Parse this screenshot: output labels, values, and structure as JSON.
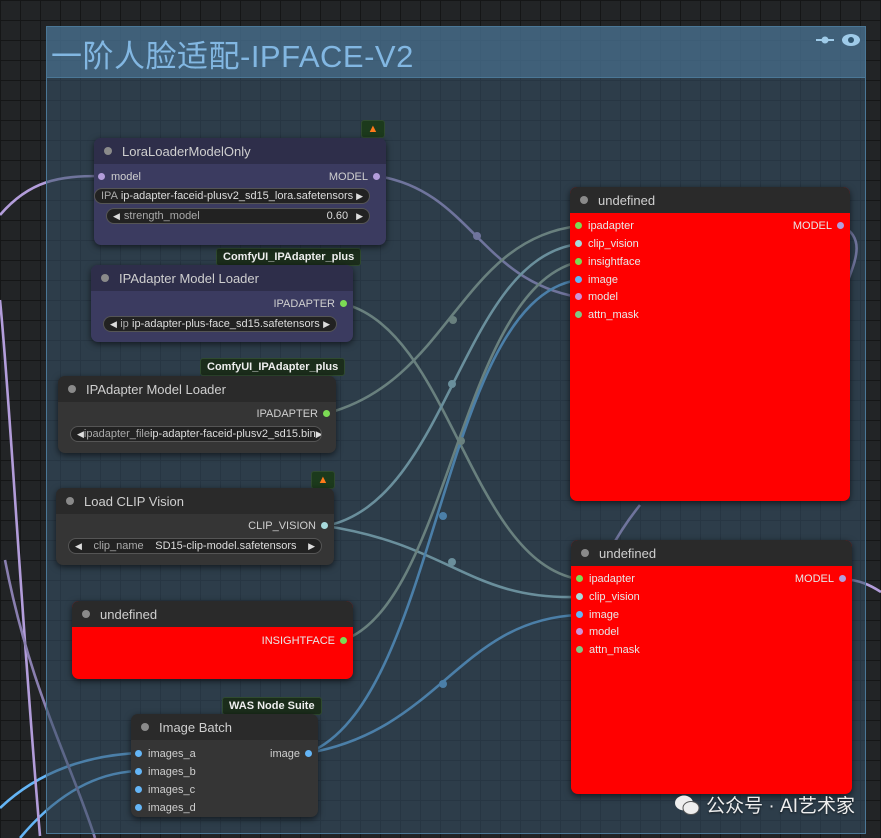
{
  "group": {
    "title": "一阶人脸适配-IPFACE-V2"
  },
  "colors": {
    "model": "#b39ddb",
    "ipadapter": "#7cdb54",
    "clip_vision": "#a8dadc",
    "insightface": "#7cdb54",
    "image": "#64b5f6",
    "mask": "#81c784",
    "red": "#ff0000"
  },
  "badges": {
    "ipadapter_plus_1": "ComfyUI_IPAdapter_plus",
    "ipadapter_plus_2": "ComfyUI_IPAdapter_plus",
    "was": "WAS Node Suite"
  },
  "lora": {
    "title": "LoraLoaderModelOnly",
    "in_model": "model",
    "out_model": "MODEL",
    "lora_label": "IPA",
    "lora_value": "ip-adapter-faceid-plusv2_sd15_lora.safetensors",
    "strength_label": "strength_model",
    "strength_value": "0.60"
  },
  "ipa_loader1": {
    "title": "IPAdapter Model Loader",
    "out": "IPADAPTER",
    "label": "ip",
    "value": "ip-adapter-plus-face_sd15.safetensors"
  },
  "ipa_loader2": {
    "title": "IPAdapter Model Loader",
    "out": "IPADAPTER",
    "label": "ipadapter_file",
    "value": "ip-adapter-faceid-plusv2_sd15.bin"
  },
  "clip": {
    "title": "Load CLIP Vision",
    "out": "CLIP_VISION",
    "label": "clip_name",
    "value": "SD15-clip-model.safetensors"
  },
  "insight": {
    "title": "undefined",
    "out": "INSIGHTFACE"
  },
  "batch": {
    "title": "Image Batch",
    "out": "image",
    "inputs": [
      "images_a",
      "images_b",
      "images_c",
      "images_d"
    ]
  },
  "apply1": {
    "title": "undefined",
    "out": "MODEL",
    "inputs": [
      "ipadapter",
      "clip_vision",
      "insightface",
      "image",
      "model",
      "attn_mask"
    ]
  },
  "apply2": {
    "title": "undefined",
    "out": "MODEL",
    "inputs": [
      "ipadapter",
      "clip_vision",
      "image",
      "model",
      "attn_mask"
    ]
  },
  "watermark": "公众号 · AI艺术家"
}
